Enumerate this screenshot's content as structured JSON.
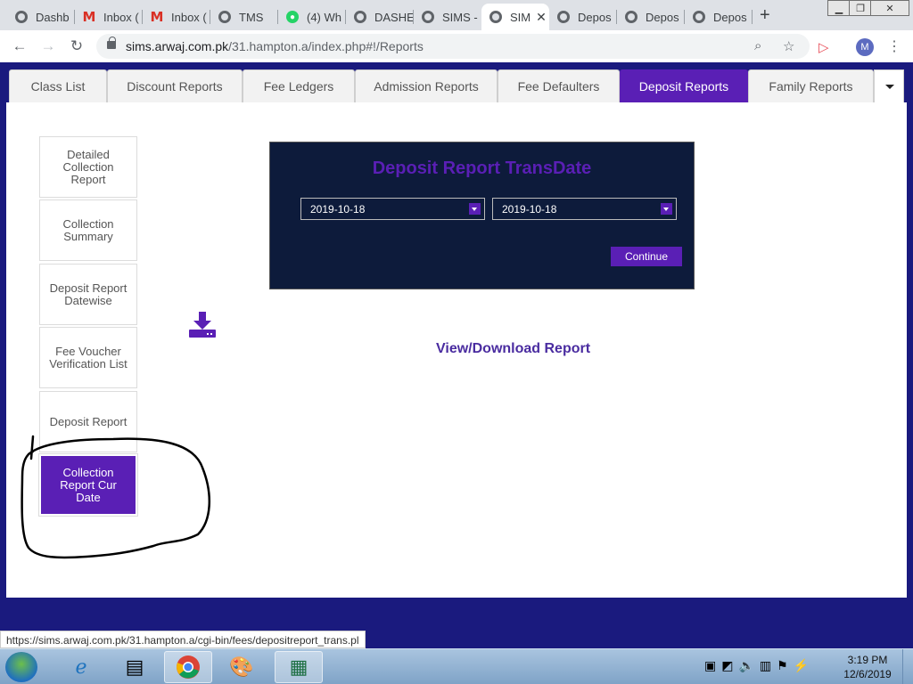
{
  "browser": {
    "tabs": [
      {
        "label": "Dashb",
        "icon": "globe-icon"
      },
      {
        "label": "Inbox (",
        "icon": "gmail-icon"
      },
      {
        "label": "Inbox (",
        "icon": "gmail-icon"
      },
      {
        "label": "TMS",
        "icon": "globe-icon"
      },
      {
        "label": "(4) Wh",
        "icon": "whatsapp-icon"
      },
      {
        "label": "DASHE",
        "icon": "globe-icon"
      },
      {
        "label": "SIMS -",
        "icon": "globe-icon"
      },
      {
        "label": "SIM",
        "icon": "globe-icon",
        "active": true
      },
      {
        "label": "Depos",
        "icon": "globe-icon"
      },
      {
        "label": "Depos",
        "icon": "globe-icon"
      },
      {
        "label": "Depos",
        "icon": "globe-icon"
      }
    ],
    "new_tab": "+",
    "url_host": "sims.arwaj.com.pk",
    "url_path": "/31.hampton.a/index.php#!/Reports",
    "avatar_letter": "M"
  },
  "app": {
    "tabs": [
      "Class List",
      "Discount Reports",
      "Fee Ledgers",
      "Admission Reports",
      "Fee Defaulters",
      "Deposit Reports",
      "Family Reports"
    ],
    "active_tab": "Deposit Reports",
    "side_menu": [
      "Detailed Collection Report",
      "Collection Summary",
      "Deposit Report Datewise",
      "Fee Voucher Verification List",
      "Deposit Report",
      "Collection Report Cur Date"
    ],
    "active_side_item": "Collection Report Cur Date",
    "panel": {
      "title": "Deposit Report TransDate",
      "from_date": "2019-10-18",
      "to_date": "2019-10-18",
      "continue_label": "Continue"
    },
    "view_download_label": "View/Download Report",
    "accent_color": "#5a1fb5"
  },
  "status_url": "https://sims.arwaj.com.pk/31.hampton.a/cgi-bin/fees/depositreport_trans.pl",
  "taskbar": {
    "time": "3:19 PM",
    "date": "12/6/2019"
  }
}
